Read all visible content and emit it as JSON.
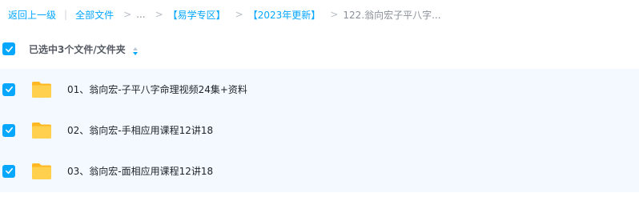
{
  "breadcrumb": {
    "back": "返回上一级",
    "all_files": "全部文件",
    "ellipsis": "...",
    "level1": "【易学专区】",
    "level2": "【2023年更新】",
    "current": "122.翁向宏子平八字..."
  },
  "selection": {
    "summary": "已选中3个文件/文件夹",
    "all_checked": true
  },
  "files": [
    {
      "name": "01、翁向宏-子平八字命理视频24集+资料",
      "checked": true,
      "icon": "folder-icon"
    },
    {
      "name": "02、翁向宏-手相应用课程12讲18",
      "checked": true,
      "icon": "folder-icon"
    },
    {
      "name": "03、翁向宏-面相应用课程12讲18",
      "checked": true,
      "icon": "folder-icon"
    }
  ],
  "colors": {
    "accent": "#06a7ff",
    "row_highlight": "#f3f9fe",
    "folder": "#ffc83d"
  }
}
